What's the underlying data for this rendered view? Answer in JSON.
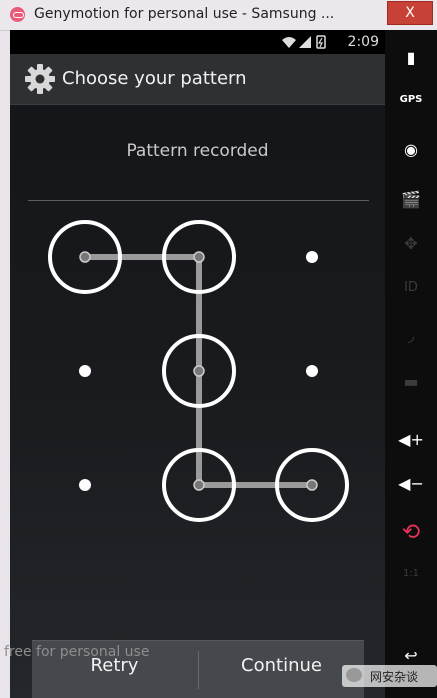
{
  "window": {
    "title": "Genymotion for personal use - Samsung ...",
    "close_label": "X"
  },
  "statusbar": {
    "time": "2:09",
    "icons": "wifi signal battery"
  },
  "actionbar": {
    "title": "Choose your pattern"
  },
  "header": {
    "text": "Pattern recorded"
  },
  "buttons": {
    "retry": "Retry",
    "continue": "Continue"
  },
  "watermark": {
    "free": "free for personal use",
    "wechat": "网安杂谈"
  },
  "sidebar": {
    "items": [
      {
        "name": "battery-icon",
        "label": "▮",
        "enabled": true
      },
      {
        "name": "gps-icon",
        "label": "GPS",
        "enabled": true
      },
      {
        "name": "camera-icon",
        "label": "◉",
        "enabled": true
      },
      {
        "name": "capture-icon",
        "label": "🎬",
        "enabled": false
      },
      {
        "name": "dpad-icon",
        "label": "✥",
        "enabled": false
      },
      {
        "name": "id-icon",
        "label": "ID",
        "enabled": false
      },
      {
        "name": "rss-icon",
        "label": "◞",
        "enabled": false
      },
      {
        "name": "sms-icon",
        "label": "▬",
        "enabled": false
      },
      {
        "name": "volume-up-icon",
        "label": "◀+",
        "enabled": true
      },
      {
        "name": "volume-down-icon",
        "label": "◀−",
        "enabled": true
      },
      {
        "name": "rotate-icon",
        "label": "⟲",
        "enabled": true
      },
      {
        "name": "scale-icon",
        "label": "1:1",
        "enabled": false
      },
      {
        "name": "back-icon",
        "label": "↩",
        "enabled": true
      }
    ]
  },
  "pattern": {
    "cells": [
      1,
      1,
      0,
      0,
      1,
      0,
      0,
      1,
      1
    ],
    "sequence": [
      1,
      2,
      5,
      8,
      9
    ]
  },
  "colors": {
    "accent": "#ffffff",
    "line": "#9a9a9a",
    "close": "#c84136"
  }
}
